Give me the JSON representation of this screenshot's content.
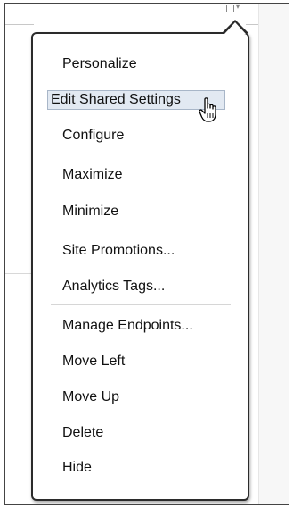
{
  "menu": {
    "items": [
      {
        "label": "Personalize"
      },
      {
        "label": "Edit Shared Settings",
        "highlighted": true
      },
      {
        "label": "Configure"
      },
      {
        "label": "Maximize"
      },
      {
        "label": "Minimize"
      },
      {
        "label": "Site Promotions..."
      },
      {
        "label": "Analytics Tags..."
      },
      {
        "label": "Manage Endpoints..."
      },
      {
        "label": "Move Left"
      },
      {
        "label": "Move Up"
      },
      {
        "label": "Delete"
      },
      {
        "label": "Hide"
      }
    ]
  },
  "icons": {
    "portlet_menu": "portlet-menu-icon",
    "cursor": "hand-pointer-cursor-icon"
  },
  "colors": {
    "highlight_background": "#e2e9f2",
    "menu_border": "#2b2b2b"
  }
}
